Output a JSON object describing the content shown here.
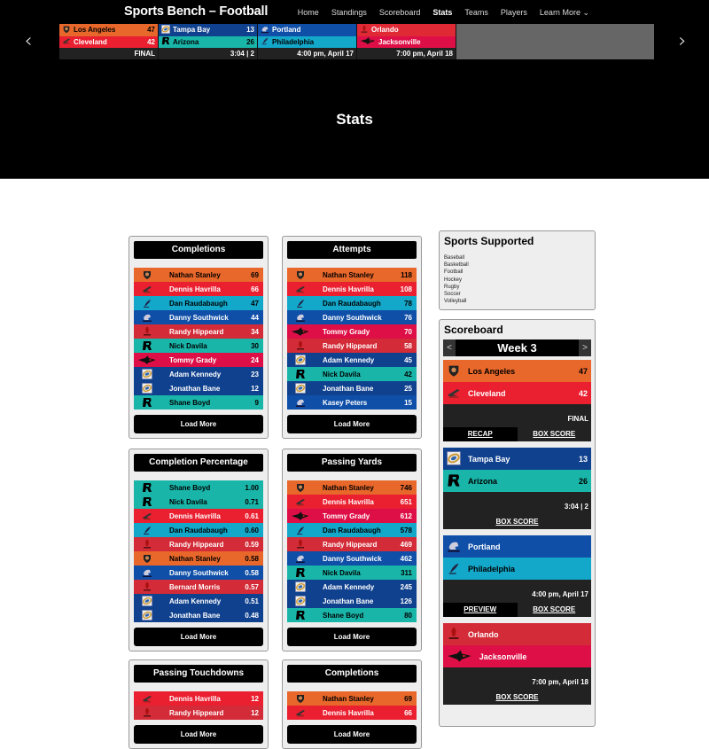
{
  "site": {
    "title": "Sports Bench – Football"
  },
  "nav": {
    "items": [
      "Home",
      "Standings",
      "Scoreboard",
      "Stats",
      "Teams",
      "Players",
      "Learn More ⌄"
    ],
    "active": "Stats"
  },
  "ticker": {
    "prev_icon": "‹",
    "next_icon": "›",
    "games": [
      {
        "away": {
          "name": "Los Angeles",
          "score": "47",
          "color": "#e8672a",
          "text": "#000"
        },
        "home": {
          "name": "Cleveland",
          "score": "42",
          "color": "#ea1f30",
          "text": "#fff"
        },
        "status": "FINAL"
      },
      {
        "away": {
          "name": "Tampa Bay",
          "score": "13",
          "color": "#10418e",
          "text": "#fff"
        },
        "home": {
          "name": "Arizona",
          "score": "26",
          "color": "#19b5a9",
          "text": "#000"
        },
        "status": "3:04 | 2"
      },
      {
        "away": {
          "name": "Portland",
          "score": "",
          "color": "#0f4fa8",
          "text": "#fff"
        },
        "home": {
          "name": "Philadelphia",
          "score": "",
          "color": "#13a7c9",
          "text": "#000"
        },
        "status": "4:00 pm, April 17"
      },
      {
        "away": {
          "name": "Orlando",
          "score": "",
          "color": "#df2a36",
          "text": "#fff"
        },
        "home": {
          "name": "Jacksonville",
          "score": "",
          "color": "#dd0f46",
          "text": "#fff"
        },
        "status": "7:00 pm, April 18"
      }
    ]
  },
  "page": {
    "title": "Stats"
  },
  "team_colors": {
    "LA": {
      "bg": "#e8672a",
      "fg": "#000",
      "logo": "shield-logo"
    },
    "CLE": {
      "bg": "#ea1f30",
      "fg": "#fff",
      "logo": "bird-logo"
    },
    "PHI": {
      "bg": "#13a7c9",
      "fg": "#000",
      "logo": "feather-logo"
    },
    "POR": {
      "bg": "#0f4fa8",
      "fg": "#fff",
      "logo": "steel-logo"
    },
    "ORL": {
      "bg": "#d32b37",
      "fg": "#fff",
      "logo": "knight-logo"
    },
    "ARI": {
      "bg": "#19b5a9",
      "fg": "#000",
      "logo": "r-logo"
    },
    "JAX": {
      "bg": "#dd0f46",
      "fg": "#fff",
      "logo": "shark-logo"
    },
    "TB": {
      "bg": "#10418e",
      "fg": "#fff",
      "logo": "football-logo"
    }
  },
  "stat_cards": [
    {
      "title": "Completions",
      "load_more": "Load More",
      "rows": [
        {
          "team": "LA",
          "name": "Nathan Stanley",
          "value": "69"
        },
        {
          "team": "CLE",
          "name": "Dennis Havrilla",
          "value": "66"
        },
        {
          "team": "PHI",
          "name": "Dan Raudabaugh",
          "value": "47"
        },
        {
          "team": "POR",
          "name": "Danny Southwick",
          "value": "44"
        },
        {
          "team": "ORL",
          "name": "Randy Hippeard",
          "value": "34"
        },
        {
          "team": "ARI",
          "name": "Nick Davila",
          "value": "30"
        },
        {
          "team": "JAX",
          "name": "Tommy Grady",
          "value": "24"
        },
        {
          "team": "TB",
          "name": "Adam Kennedy",
          "value": "23"
        },
        {
          "team": "TB",
          "name": "Jonathan Bane",
          "value": "12"
        },
        {
          "team": "ARI",
          "name": "Shane Boyd",
          "value": "9"
        }
      ]
    },
    {
      "title": "Attempts",
      "load_more": "Load More",
      "rows": [
        {
          "team": "LA",
          "name": "Nathan Stanley",
          "value": "118"
        },
        {
          "team": "CLE",
          "name": "Dennis Havrilla",
          "value": "108"
        },
        {
          "team": "PHI",
          "name": "Dan Raudabaugh",
          "value": "78"
        },
        {
          "team": "POR",
          "name": "Danny Southwick",
          "value": "76"
        },
        {
          "team": "JAX",
          "name": "Tommy Grady",
          "value": "70"
        },
        {
          "team": "ORL",
          "name": "Randy Hippeard",
          "value": "58"
        },
        {
          "team": "TB",
          "name": "Adam Kennedy",
          "value": "45"
        },
        {
          "team": "ARI",
          "name": "Nick Davila",
          "value": "42"
        },
        {
          "team": "TB",
          "name": "Jonathan Bane",
          "value": "25"
        },
        {
          "team": "POR",
          "name": "Kasey Peters",
          "value": "15"
        }
      ]
    },
    {
      "title": "Completion Percentage",
      "load_more": "Load More",
      "rows": [
        {
          "team": "ARI",
          "name": "Shane Boyd",
          "value": "1.00"
        },
        {
          "team": "ARI",
          "name": "Nick Davila",
          "value": "0.71"
        },
        {
          "team": "CLE",
          "name": "Dennis Havrilla",
          "value": "0.61"
        },
        {
          "team": "PHI",
          "name": "Dan Raudabaugh",
          "value": "0.60"
        },
        {
          "team": "ORL",
          "name": "Randy Hippeard",
          "value": "0.59"
        },
        {
          "team": "LA",
          "name": "Nathan Stanley",
          "value": "0.58"
        },
        {
          "team": "POR",
          "name": "Danny Southwick",
          "value": "0.58"
        },
        {
          "team": "ORL",
          "name": "Bernard Morris",
          "value": "0.57"
        },
        {
          "team": "TB",
          "name": "Adam Kennedy",
          "value": "0.51"
        },
        {
          "team": "TB",
          "name": "Jonathan Bane",
          "value": "0.48"
        }
      ]
    },
    {
      "title": "Passing Yards",
      "load_more": "Load More",
      "rows": [
        {
          "team": "LA",
          "name": "Nathan Stanley",
          "value": "746"
        },
        {
          "team": "CLE",
          "name": "Dennis Havrilla",
          "value": "651"
        },
        {
          "team": "JAX",
          "name": "Tommy Grady",
          "value": "612"
        },
        {
          "team": "PHI",
          "name": "Dan Raudabaugh",
          "value": "578"
        },
        {
          "team": "ORL",
          "name": "Randy Hippeard",
          "value": "469"
        },
        {
          "team": "POR",
          "name": "Danny Southwick",
          "value": "462"
        },
        {
          "team": "ARI",
          "name": "Nick Davila",
          "value": "311"
        },
        {
          "team": "TB",
          "name": "Adam Kennedy",
          "value": "245"
        },
        {
          "team": "TB",
          "name": "Jonathan Bane",
          "value": "126"
        },
        {
          "team": "ARI",
          "name": "Shane Boyd",
          "value": "80"
        }
      ]
    },
    {
      "title": "Passing Touchdowns",
      "load_more": "Load More",
      "rows": [
        {
          "team": "CLE",
          "name": "Dennis Havrilla",
          "value": "12"
        },
        {
          "team": "ORL",
          "name": "Randy Hippeard",
          "value": "12"
        }
      ]
    },
    {
      "title": "Completions",
      "load_more": "Load More",
      "rows": [
        {
          "team": "LA",
          "name": "Nathan Stanley",
          "value": "69"
        },
        {
          "team": "CLE",
          "name": "Dennis Havrilla",
          "value": "66"
        }
      ]
    }
  ],
  "sidebar": {
    "sports": {
      "title": "Sports Supported",
      "items": [
        "Baseball",
        "Basketball",
        "Football",
        "Hockey",
        "Rugby",
        "Soccer",
        "Volleyball"
      ]
    },
    "scoreboard": {
      "title": "Scoreboard",
      "week": "Week 3",
      "prev": "<",
      "next": ">",
      "games": [
        {
          "away": {
            "team": "LA",
            "name": "Los Angeles",
            "score": "47"
          },
          "home": {
            "team": "CLE",
            "name": "Cleveland",
            "score": "42"
          },
          "status": "FINAL",
          "links": [
            "RECAP",
            "BOX SCORE"
          ]
        },
        {
          "away": {
            "team": "TB",
            "name": "Tampa Bay",
            "score": "13"
          },
          "home": {
            "team": "ARI",
            "name": "Arizona",
            "score": "26"
          },
          "status": "3:04 | 2",
          "links": [
            "BOX SCORE"
          ]
        },
        {
          "away": {
            "team": "POR",
            "name": "Portland",
            "score": ""
          },
          "home": {
            "team": "PHI",
            "name": "Philadelphia",
            "score": ""
          },
          "status": "4:00 pm, April 17",
          "links": [
            "PREVIEW",
            "BOX SCORE"
          ]
        },
        {
          "away": {
            "team": "ORL",
            "name": "Orlando",
            "score": ""
          },
          "home": {
            "team": "JAX",
            "name": "Jacksonville",
            "score": ""
          },
          "status": "7:00 pm, April 18",
          "links": [
            "BOX SCORE"
          ]
        }
      ]
    }
  }
}
